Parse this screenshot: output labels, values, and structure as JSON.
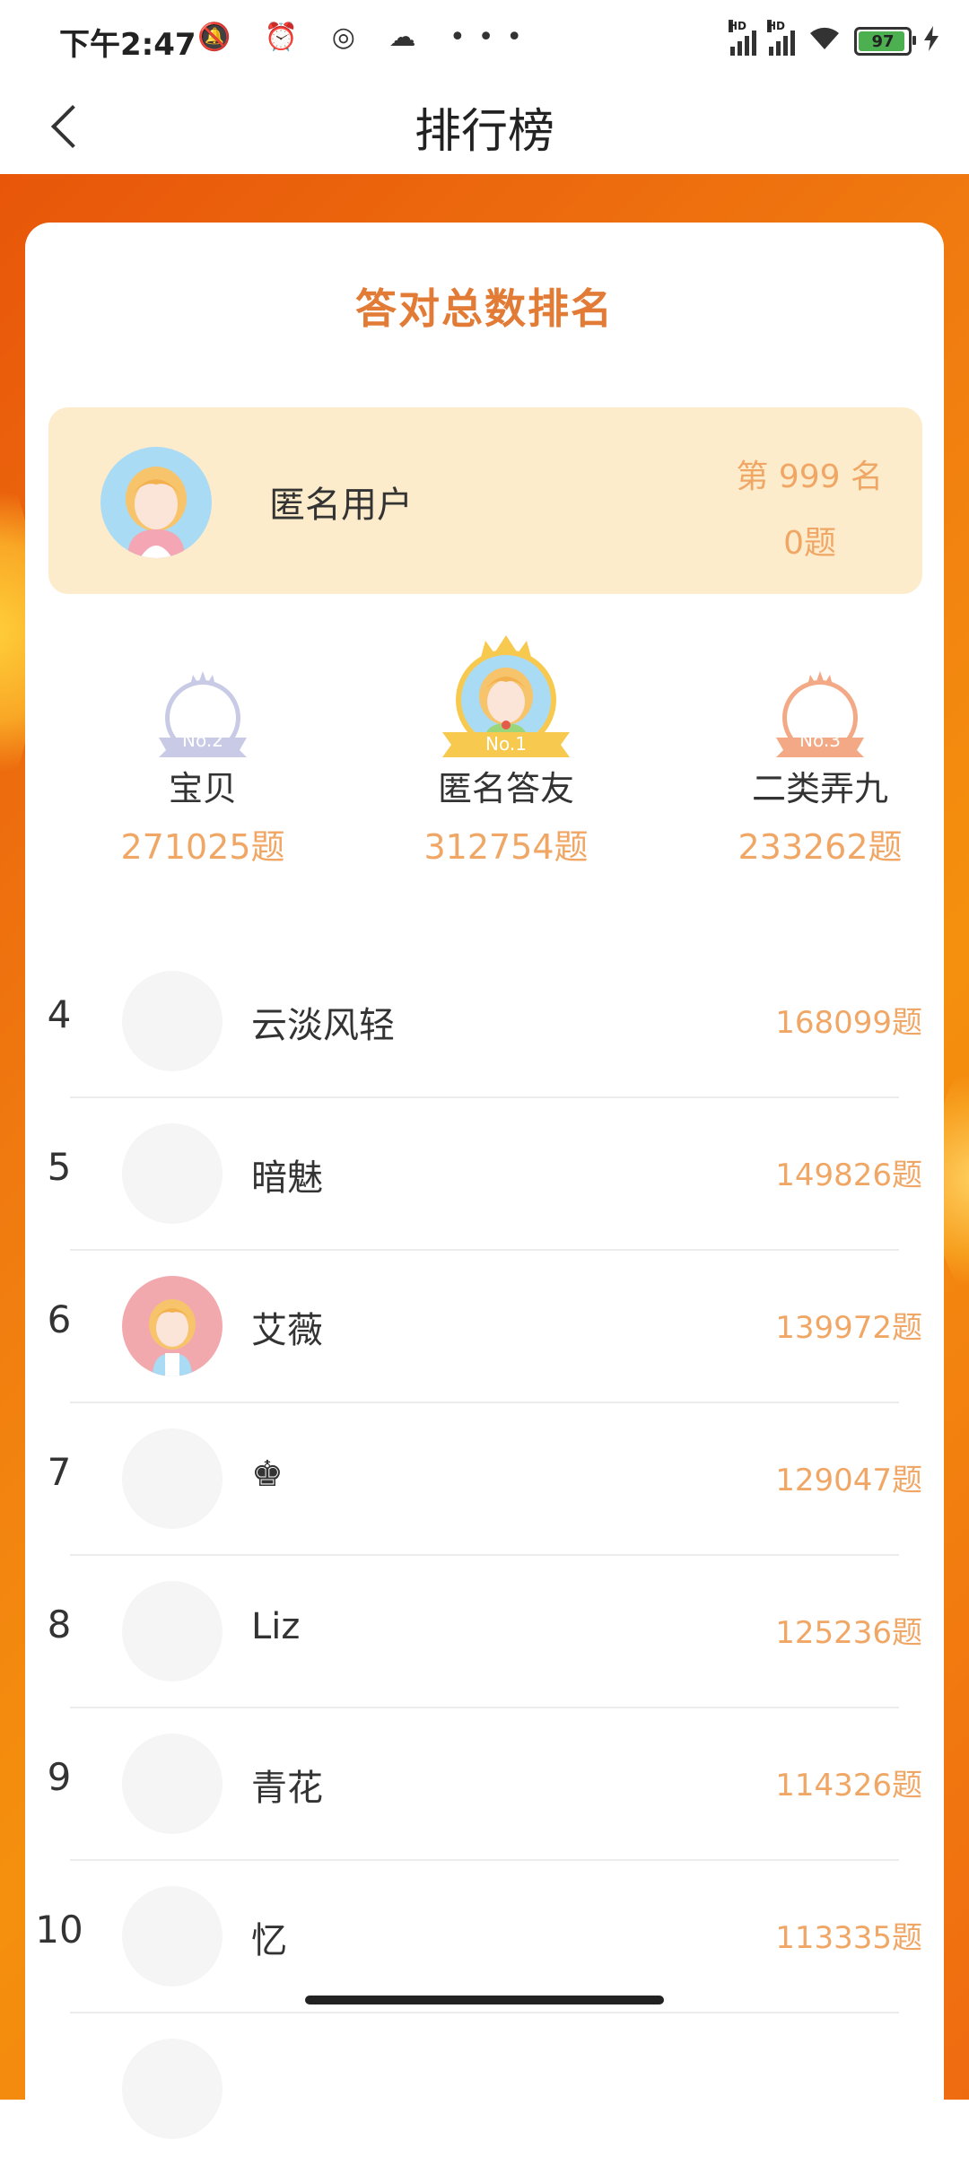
{
  "status_bar": {
    "time": "下午2:47",
    "notification_icons": "🔕 ⏰ ◎ ☁ •••",
    "network_tag_1": "HD",
    "network_tag_2": "HD",
    "battery_level": "97"
  },
  "header": {
    "title": "排行榜",
    "back_icon": "chevron-left-icon"
  },
  "card": {
    "title": "答对总数排名"
  },
  "me": {
    "name": "匿名用户",
    "rank": "第 999 名",
    "count": "0题"
  },
  "podium": [
    {
      "badge": "No.2",
      "name": "宝贝",
      "count": "271025题",
      "color": "#c9cbe6"
    },
    {
      "badge": "No.1",
      "name": "匿名答友",
      "count": "312754题",
      "color": "#f7c94f"
    },
    {
      "badge": "No.3",
      "name": "二类弄九",
      "count": "233262题",
      "color": "#f3a985"
    }
  ],
  "ranking": [
    {
      "rank": "4",
      "name": "云淡风轻",
      "count": "168099题"
    },
    {
      "rank": "5",
      "name": "暗魅",
      "count": "149826题"
    },
    {
      "rank": "6",
      "name": "艾薇",
      "count": "139972题"
    },
    {
      "rank": "7",
      "name": "♚",
      "count": "129047题"
    },
    {
      "rank": "8",
      "name": "Liz",
      "count": "125236题"
    },
    {
      "rank": "9",
      "name": "青花",
      "count": "114326题"
    },
    {
      "rank": "10",
      "name": "忆",
      "count": "113335题"
    }
  ],
  "colors": {
    "accent": "#e27b35",
    "count": "#f0a766",
    "background_orange": "#f07a10",
    "me_card": "#fdeccb"
  }
}
